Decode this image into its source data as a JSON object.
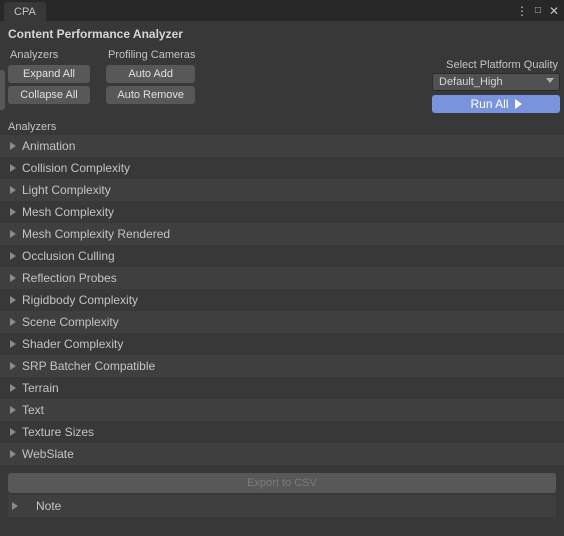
{
  "tab_title": "CPA",
  "header": "Content Performance Analyzer",
  "labels": {
    "analyzers_col": "Analyzers",
    "cameras_col": "Profiling Cameras",
    "select_quality": "Select Platform Quality",
    "analyzers_section": "Analyzers"
  },
  "buttons": {
    "expand_all": "Expand All",
    "collapse_all": "Collapse All",
    "auto_add": "Auto Add",
    "auto_remove": "Auto Remove",
    "run_all": "Run All",
    "export_csv": "Export to CSV"
  },
  "dropdown": {
    "quality_selected": "Default_High"
  },
  "analyzers": [
    "Animation",
    "Collision Complexity",
    "Light Complexity",
    "Mesh Complexity",
    "Mesh Complexity Rendered",
    "Occlusion Culling",
    "Reflection Probes",
    "Rigidbody Complexity",
    "Scene Complexity",
    "Shader Complexity",
    "SRP Batcher Compatible",
    "Terrain",
    "Text",
    "Texture Sizes",
    "WebSlate"
  ],
  "note_label": "Note"
}
